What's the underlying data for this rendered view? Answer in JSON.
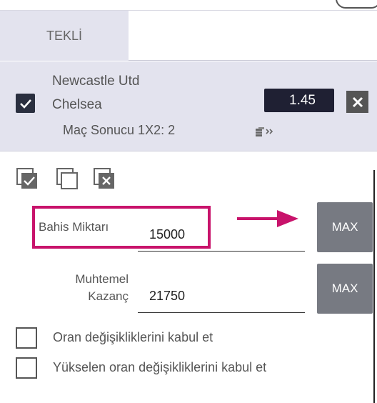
{
  "tabs": [
    {
      "label": "TEKLİ",
      "active": true
    }
  ],
  "bet": {
    "team1": "Newcastle Utd",
    "team2": "Chelsea",
    "market": "Maç Sonucu 1X2: 2",
    "odds": "1.45",
    "checked": true
  },
  "stake": {
    "label": "Bahis Miktarı",
    "value": "15000",
    "max_label": "MAX"
  },
  "winnings": {
    "label_line1": "Muhtemel",
    "label_line2": "Kazanç",
    "value": "21750",
    "max_label": "MAX"
  },
  "options": [
    {
      "label": "Oran değişikliklerini kabul et",
      "checked": false
    },
    {
      "label": "Yükselen oran değişikliklerini kabul et",
      "checked": false
    }
  ],
  "colors": {
    "accent_highlight": "#c8136b",
    "odds_bg": "#1f2033",
    "panel_bg": "#e3e3ee",
    "max_bg": "#777a82"
  }
}
